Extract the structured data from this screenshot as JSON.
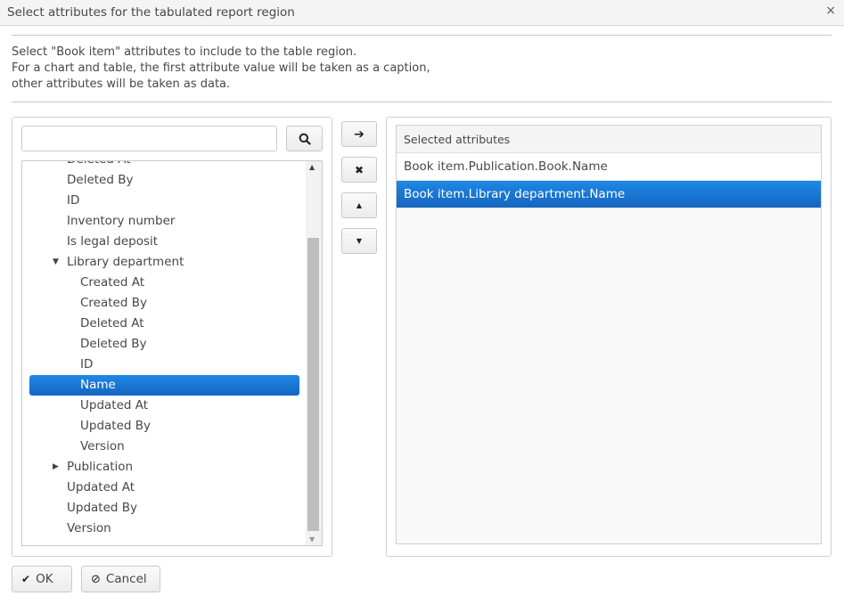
{
  "dialog": {
    "title": "Select attributes for the tabulated report region",
    "close_icon": "×"
  },
  "description": {
    "lines": [
      "Select \"Book item\" attributes to include to the table region.",
      "For a chart and table, the first attribute value will be taken as a caption,",
      "other attributes will be taken as data."
    ]
  },
  "search": {
    "value": "",
    "placeholder": "",
    "button_icon": "search-icon"
  },
  "tree": {
    "items": [
      {
        "label": "Deleted At",
        "level": 1,
        "toggle": null,
        "selected": false
      },
      {
        "label": "Deleted By",
        "level": 1,
        "toggle": null,
        "selected": false
      },
      {
        "label": "ID",
        "level": 1,
        "toggle": null,
        "selected": false
      },
      {
        "label": "Inventory number",
        "level": 1,
        "toggle": null,
        "selected": false
      },
      {
        "label": "Is legal deposit",
        "level": 1,
        "toggle": null,
        "selected": false
      },
      {
        "label": "Library department",
        "level": 1,
        "toggle": "expanded",
        "selected": false
      },
      {
        "label": "Created At",
        "level": 2,
        "toggle": null,
        "selected": false
      },
      {
        "label": "Created By",
        "level": 2,
        "toggle": null,
        "selected": false
      },
      {
        "label": "Deleted At",
        "level": 2,
        "toggle": null,
        "selected": false
      },
      {
        "label": "Deleted By",
        "level": 2,
        "toggle": null,
        "selected": false
      },
      {
        "label": "ID",
        "level": 2,
        "toggle": null,
        "selected": false
      },
      {
        "label": "Name",
        "level": 2,
        "toggle": null,
        "selected": true
      },
      {
        "label": "Updated At",
        "level": 2,
        "toggle": null,
        "selected": false
      },
      {
        "label": "Updated By",
        "level": 2,
        "toggle": null,
        "selected": false
      },
      {
        "label": "Version",
        "level": 2,
        "toggle": null,
        "selected": false
      },
      {
        "label": "Publication",
        "level": 1,
        "toggle": "collapsed",
        "selected": false
      },
      {
        "label": "Updated At",
        "level": 1,
        "toggle": null,
        "selected": false
      },
      {
        "label": "Updated By",
        "level": 1,
        "toggle": null,
        "selected": false
      },
      {
        "label": "Version",
        "level": 1,
        "toggle": null,
        "selected": false
      }
    ]
  },
  "controls": {
    "add_icon": "➔",
    "remove_icon": "✖",
    "up_icon": "▲",
    "down_icon": "▼"
  },
  "selected": {
    "header": "Selected attributes",
    "rows": [
      {
        "label": "Book item.Publication.Book.Name",
        "selected": false
      },
      {
        "label": "Book item.Library department.Name",
        "selected": true
      }
    ]
  },
  "footer": {
    "ok_label": "OK",
    "ok_icon": "✔",
    "cancel_label": "Cancel",
    "cancel_icon": "⊘"
  },
  "colors": {
    "selection": "#1976d2"
  }
}
